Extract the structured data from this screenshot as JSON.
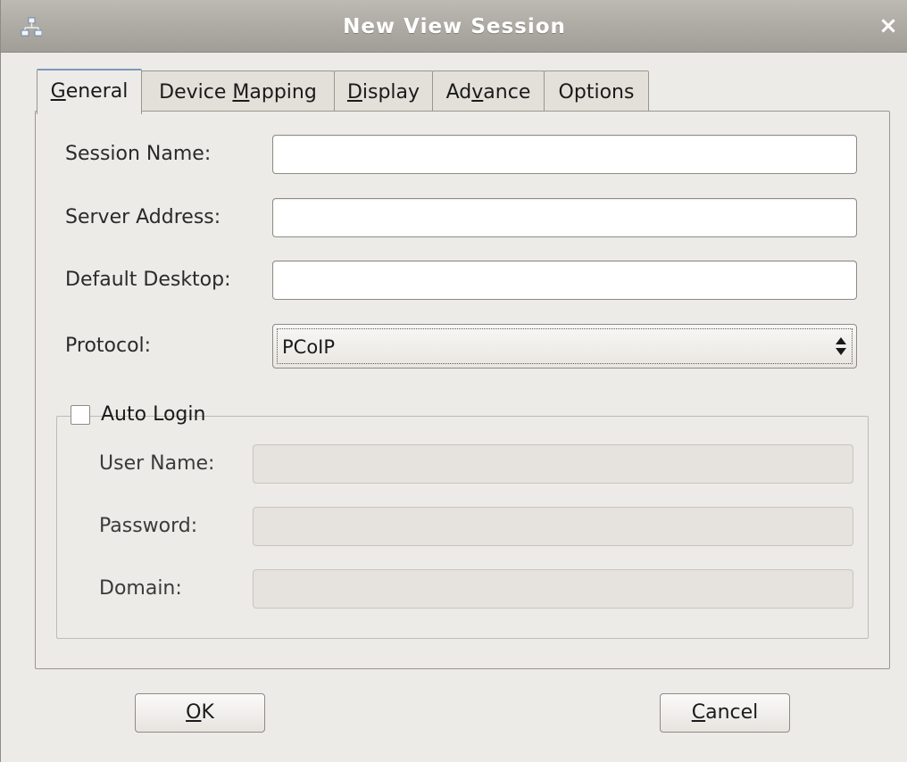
{
  "window": {
    "title": "New View Session",
    "icon": "network-icon",
    "close_glyph": "×"
  },
  "tabs": [
    {
      "pre": "",
      "u": "G",
      "post": "eneral",
      "active": true
    },
    {
      "pre": "Device ",
      "u": "M",
      "post": "apping",
      "active": false
    },
    {
      "pre": "",
      "u": "D",
      "post": "isplay",
      "active": false
    },
    {
      "pre": "Ad",
      "u": "v",
      "post": "ance",
      "active": false
    },
    {
      "pre": "Options",
      "u": "",
      "post": "",
      "active": false
    }
  ],
  "general": {
    "session_name_label": "Session Name:",
    "session_name_value": "",
    "server_address_label": "Server Address:",
    "server_address_value": "",
    "default_desktop_label": "Default Desktop:",
    "default_desktop_value": "",
    "protocol_label": "Protocol:",
    "protocol_value": "PCoIP"
  },
  "auto_login": {
    "label": "Auto Login",
    "checked": false,
    "user_name_label": "User Name:",
    "user_name_value": "",
    "password_label": "Password:",
    "password_value": "",
    "domain_label": "Domain:",
    "domain_value": ""
  },
  "buttons": {
    "ok": {
      "u": "O",
      "post": "K"
    },
    "cancel": {
      "u": "C",
      "post": "ancel"
    }
  },
  "colors": {
    "background": "#edebe7",
    "titlebar": "#aeaba5",
    "active_tab_accent": "#7e97be"
  }
}
